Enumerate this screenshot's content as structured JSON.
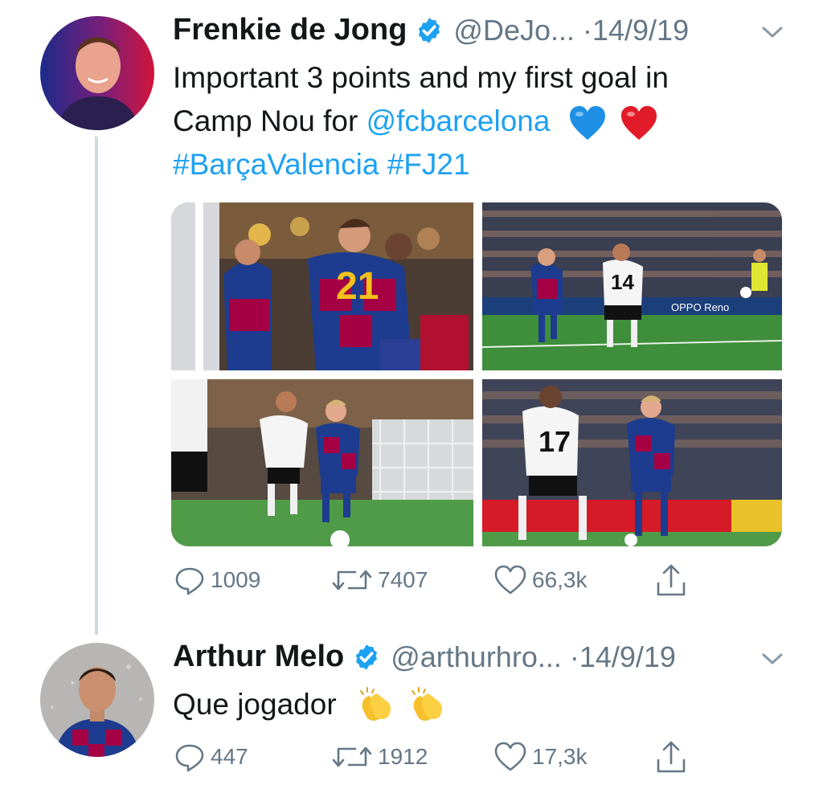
{
  "tweets": [
    {
      "name": "Frenkie de Jong",
      "handle": "@DeJo...",
      "date": "·14/9/19",
      "text": {
        "line1": "Important 3 points and my first goal in",
        "line2_prefix": "Camp Nou for ",
        "mention": "@fcbarcelona",
        "hashtag1": "#BarçaValencia",
        "hashtag2": "#FJ21"
      },
      "photos": [
        {
          "jersey": "21"
        },
        {
          "jersey": "14"
        },
        {
          "jersey": ""
        },
        {
          "jersey": "17"
        }
      ],
      "board_text": "OPPO Reno",
      "stats": {
        "replies": "1009",
        "retweets": "7407",
        "likes": "66,3k"
      }
    },
    {
      "name": "Arthur Melo",
      "handle": "@arthurhro...",
      "date": "·14/9/19",
      "text": {
        "body": "Que jogador"
      },
      "stats": {
        "replies": "447",
        "retweets": "1912",
        "likes": "17,3k"
      }
    }
  ],
  "icons": {
    "verified": "verified-badge-icon",
    "chevron": "chevron-down-icon",
    "reply": "reply-icon",
    "retweet": "retweet-icon",
    "like": "heart-icon",
    "share": "share-icon",
    "blue_heart": "blue-heart-emoji",
    "red_heart": "red-heart-emoji",
    "clap": "clapping-hands-emoji"
  },
  "colors": {
    "link": "#1da1f2",
    "secondary": "#657786",
    "barca_blue": "#1d3c8f",
    "barca_red": "#a50044",
    "pitch": "#3e8e3b"
  }
}
